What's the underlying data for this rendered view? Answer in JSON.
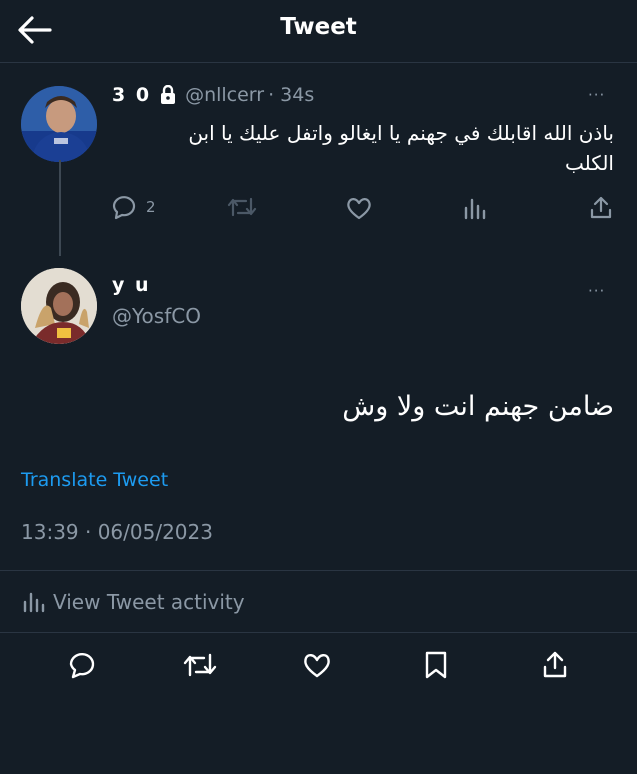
{
  "header": {
    "title": "Tweet",
    "back_icon": "arrow-left-icon"
  },
  "parent_tweet": {
    "display_name": "3 0",
    "lock_icon": "lock-icon",
    "handle": "@nllcerr",
    "time": "· 34s",
    "more": "···",
    "text_line1": "باذن الله اقابلك في جهنم يا ايغالو واتفل عليك يا ابن",
    "text_line2": "الكلب",
    "reply_count": "2"
  },
  "main_tweet": {
    "display_name": "y u",
    "handle": "@YosfCO",
    "more": "···",
    "text": "ضامن جهنم انت ولا وش",
    "translate_label": "Translate Tweet",
    "timestamp": "13:39 · 06/05/2023",
    "activity_label": "View Tweet activity"
  },
  "colors": {
    "background": "#141d26",
    "accent": "#1d9bf0",
    "muted": "#8b98a5",
    "divider": "#2a3542"
  }
}
